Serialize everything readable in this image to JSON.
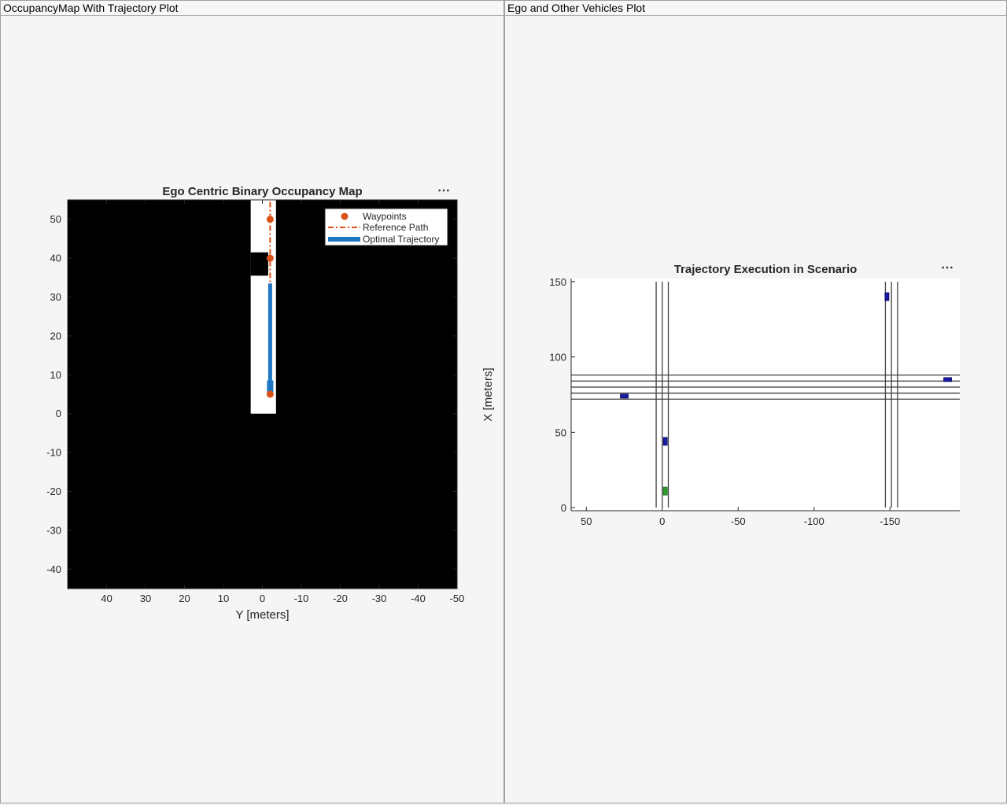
{
  "panels": {
    "left_title": "OccupancyMap With Trajectory Plot",
    "right_title": "Ego and Other Vehicles Plot",
    "axes_menu_label": "⋯"
  },
  "colors": {
    "waypoint": "#d95319",
    "reference_path": "#d95319",
    "trajectory": "#1f77c4",
    "occupied": "#000000",
    "free": "#ffffff",
    "road_line": "#404040",
    "vehicle_other": "#1a1aa6",
    "vehicle_ego": "#2ca02c"
  },
  "chart_data": [
    {
      "type": "scatter",
      "title": "Ego Centric Binary Occupancy Map",
      "xlabel": "Y [meters]",
      "ylabel": "",
      "xlim": [
        50,
        -50
      ],
      "ylim": [
        -45,
        55
      ],
      "x_reversed": true,
      "xticks": [
        40,
        30,
        20,
        10,
        0,
        -10,
        -20,
        -30,
        -40,
        -50
      ],
      "yticks": [
        50,
        40,
        30,
        20,
        10,
        0,
        -10,
        -20,
        -30,
        -40
      ],
      "grid": false,
      "legend_position": "top-right",
      "legend": [
        "Waypoints",
        "Reference Path",
        "Optimal Trajectory"
      ],
      "free_regions": [
        {
          "y_min": -3.5,
          "y_max": 3.0,
          "x_min": 0,
          "x_max": 55
        },
        {
          "y_min": -1.5,
          "y_max": 3.0,
          "x_min": 35.5,
          "x_max": 41.5,
          "occupied": true
        }
      ],
      "series": [
        {
          "name": "Waypoints",
          "kind": "points",
          "x": [
            -2,
            -2,
            -2
          ],
          "y": [
            50,
            40,
            5
          ]
        },
        {
          "name": "Reference Path",
          "kind": "dashdot-line",
          "x": [
            -2,
            -2
          ],
          "y": [
            4.5,
            55
          ]
        },
        {
          "name": "Optimal Trajectory",
          "kind": "thick-line",
          "x": [
            -2,
            -2
          ],
          "y": [
            4.5,
            33.5
          ]
        }
      ]
    },
    {
      "type": "scatter",
      "title": "Trajectory Execution in Scenario",
      "xlabel": "",
      "ylabel": "X [meters]",
      "xlim": [
        60,
        -196
      ],
      "ylim": [
        -2,
        152
      ],
      "x_reversed": true,
      "xticks": [
        50,
        0,
        -50,
        -100,
        -150
      ],
      "yticks": [
        150,
        100,
        50,
        0
      ],
      "grid": false,
      "road_lines_x": [
        4,
        0,
        -4,
        -147,
        -151,
        -155
      ],
      "road_lines_y": [
        72,
        76,
        80,
        84,
        88
      ],
      "vehicles": [
        {
          "role": "other",
          "x": -148,
          "y": 140,
          "heading": "vertical"
        },
        {
          "role": "other",
          "x": -188,
          "y": 85,
          "heading": "horizontal"
        },
        {
          "role": "other",
          "x": 25,
          "y": 74,
          "heading": "horizontal"
        },
        {
          "role": "other",
          "x": -2,
          "y": 44,
          "heading": "vertical"
        },
        {
          "role": "ego",
          "x": -2,
          "y": 11,
          "heading": "vertical"
        }
      ]
    }
  ]
}
